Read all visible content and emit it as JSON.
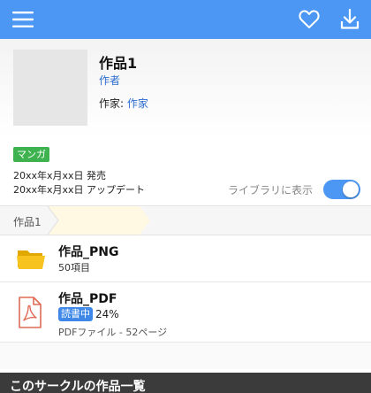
{
  "topbar": {
    "menu_icon": "hamburger-menu-icon",
    "favorite_icon": "heart-outline-icon",
    "download_icon": "download-icon",
    "bg_color": "#4c97f3"
  },
  "work": {
    "title": "作品1",
    "author": "作者",
    "credit_label": "作家: ",
    "credit_name": "作家"
  },
  "meta": {
    "genre": "マンガ",
    "genre_color": "#3db24e",
    "release": "20xx年x月xx日 発売",
    "updated": "20xx年x月xx日 アップデート",
    "library_label": "ライブラリに表示",
    "library_toggle_on": true
  },
  "breadcrumb": {
    "items": [
      "作品1",
      ""
    ]
  },
  "files": [
    {
      "icon": "folder-icon",
      "name": "作品_PNG",
      "sub": "50項目"
    },
    {
      "icon": "pdf-file-icon",
      "name": "作品_PDF",
      "badge": "読書中",
      "progress": "24%",
      "sub": "PDFファイル - 52ページ"
    }
  ],
  "section": {
    "title": "このサークルの作品一覧"
  }
}
